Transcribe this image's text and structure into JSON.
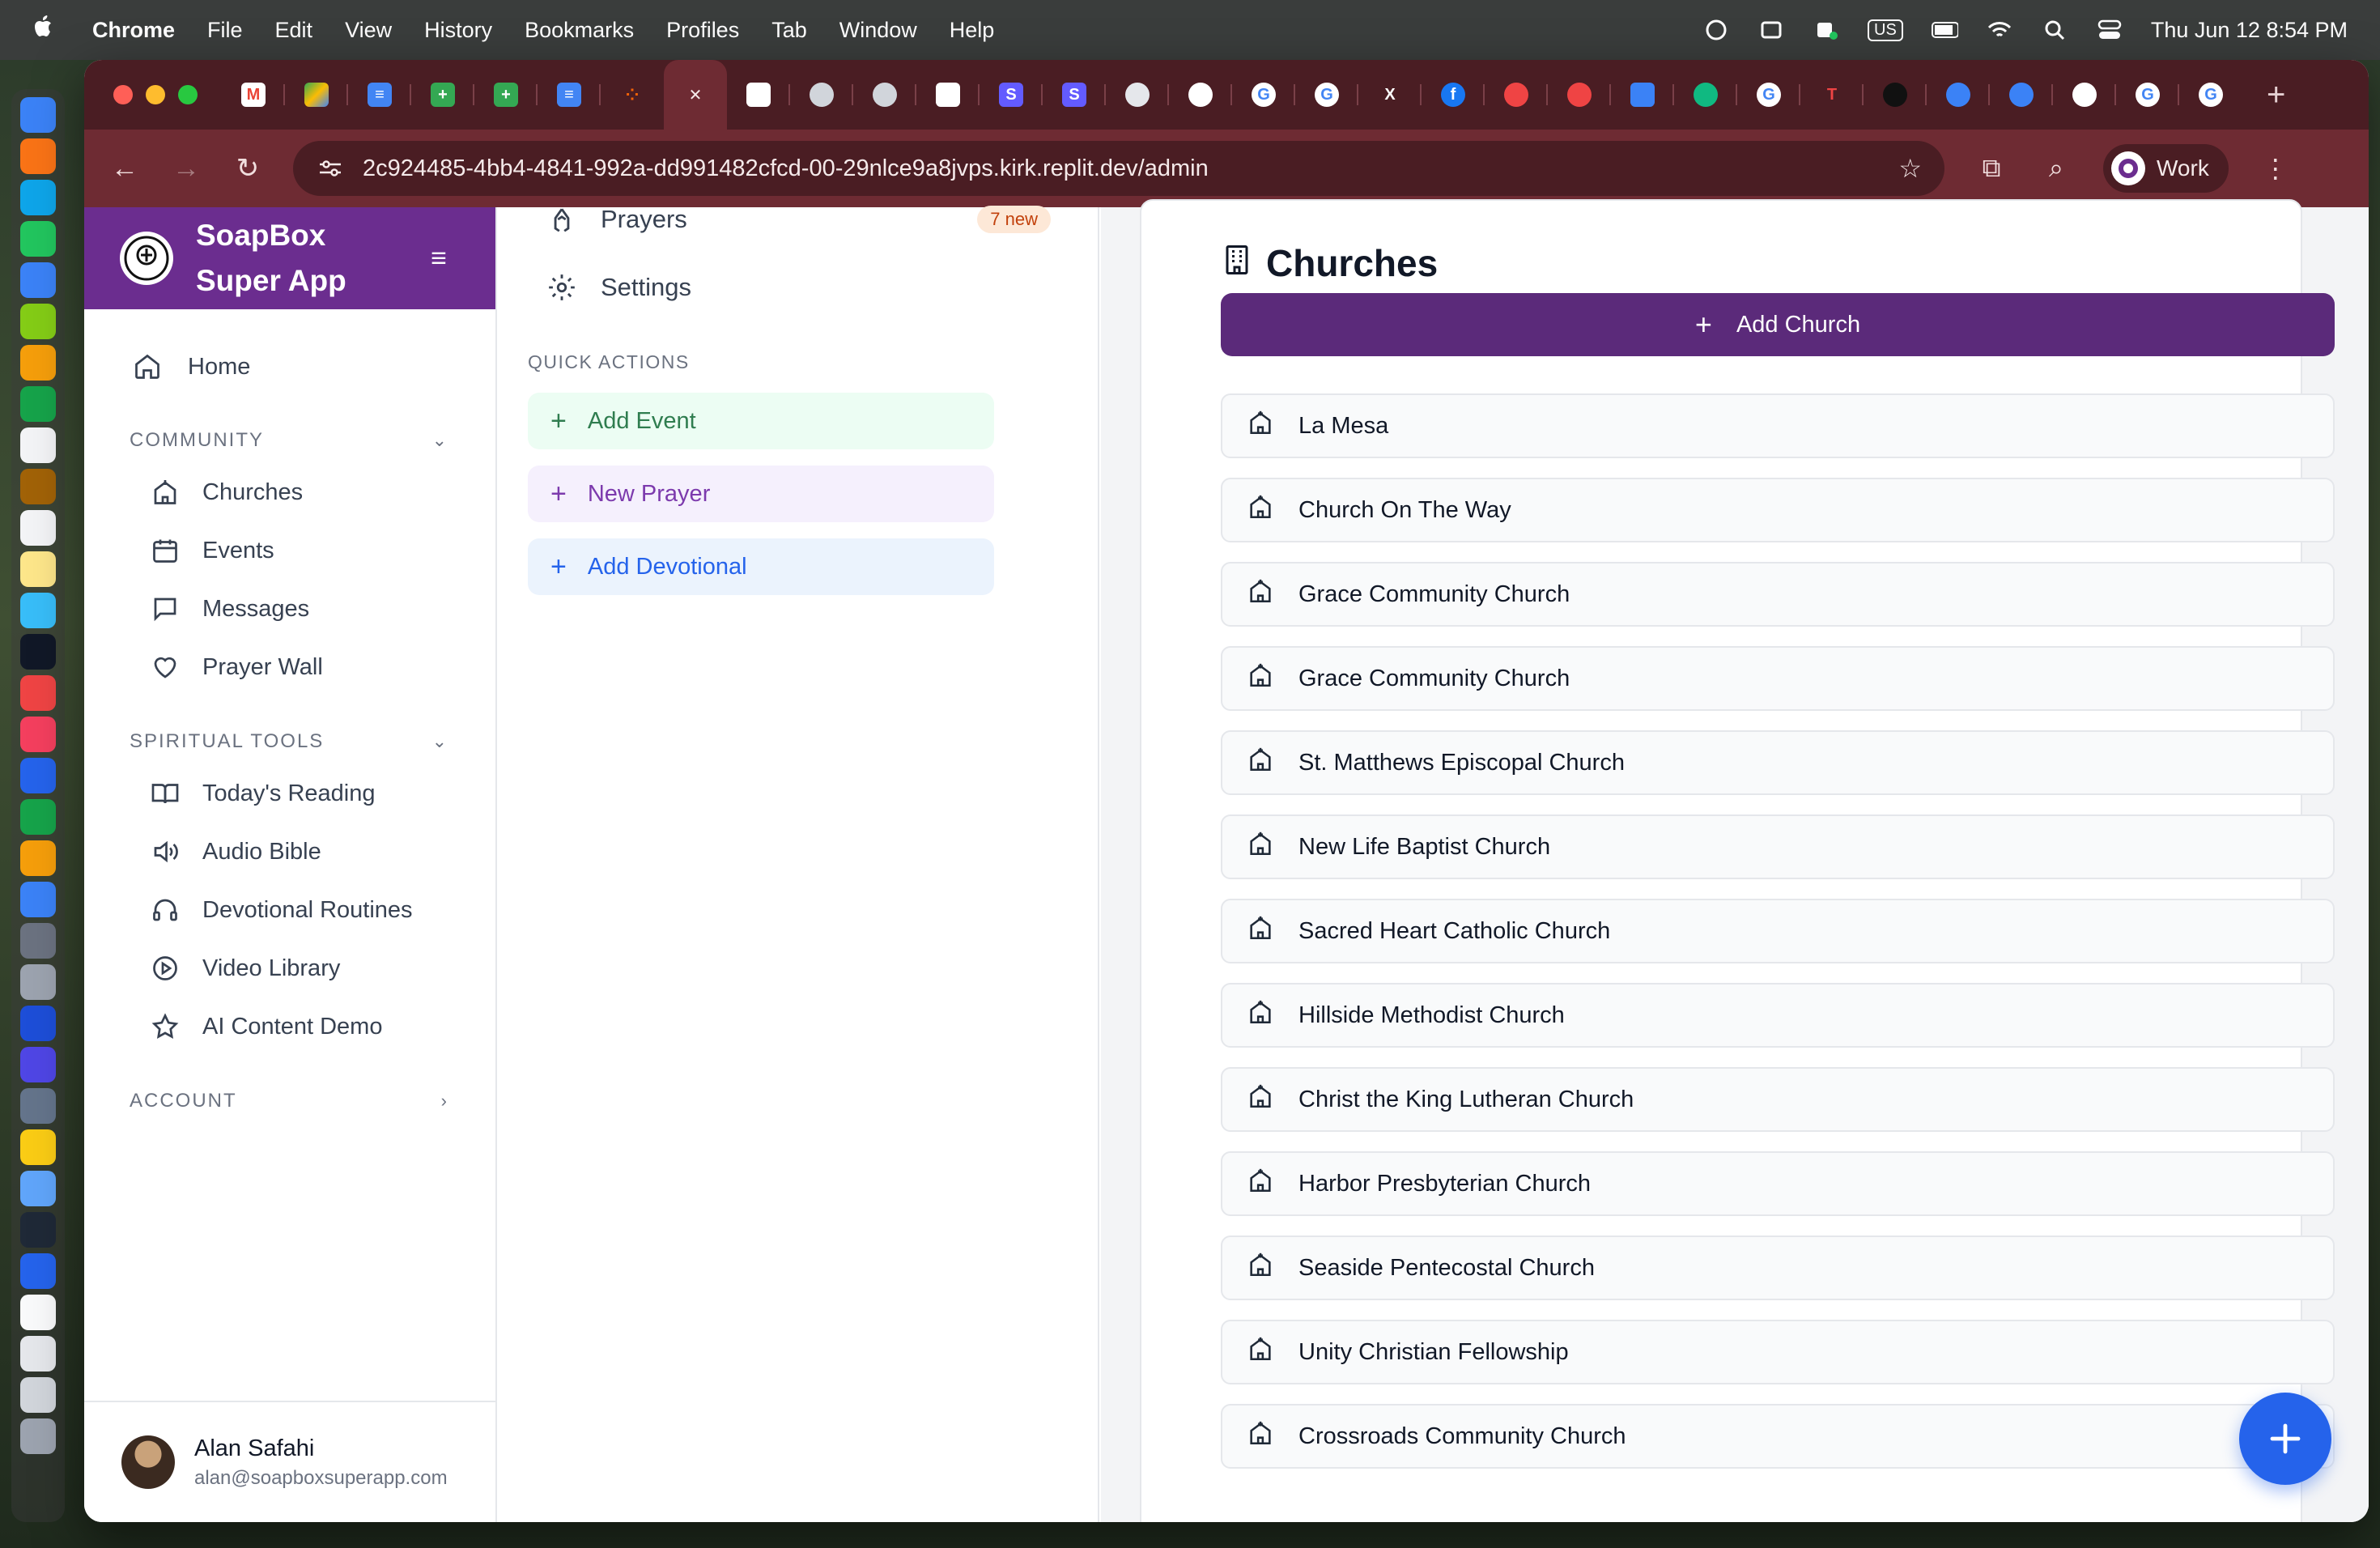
{
  "menubar": {
    "app": "Chrome",
    "items": [
      "File",
      "Edit",
      "View",
      "History",
      "Bookmarks",
      "Profiles",
      "Tab",
      "Window",
      "Help"
    ],
    "keyboard": "US",
    "datetime": "Thu Jun 12  8:54 PM"
  },
  "browser": {
    "url": "2c924485-4bb4-4841-992a-dd991482cfcd-00-29nlce9a8jvps.kirk.replit.dev/admin",
    "profile_label": "Work",
    "close_tab_glyph": "✕",
    "new_tab_glyph": "+"
  },
  "sidebar": {
    "brand_line1": "SoapBox",
    "brand_line2": "Super App",
    "home_label": "Home",
    "community_header": "COMMUNITY",
    "community_items": [
      "Churches",
      "Events",
      "Messages",
      "Prayer Wall"
    ],
    "tools_header": "SPIRITUAL TOOLS",
    "tools_items": [
      "Today's Reading",
      "Audio Bible",
      "Devotional Routines",
      "Video Library",
      "AI Content Demo"
    ],
    "account_header": "ACCOUNT",
    "user_name": "Alan Safahi",
    "user_email": "alan@soapboxsuperapp.com"
  },
  "midcol": {
    "prayers_label": "Prayers",
    "prayers_badge": "7 new",
    "settings_label": "Settings",
    "quick_actions_title": "QUICK ACTIONS",
    "qa_add_event": "Add Event",
    "qa_new_prayer": "New Prayer",
    "qa_add_devotional": "Add Devotional"
  },
  "main": {
    "title": "Churches",
    "add_button": "Add Church",
    "churches": [
      "La Mesa",
      "Church On The Way",
      "Grace Community Church",
      "Grace Community Church",
      "St. Matthews Episcopal Church",
      "New Life Baptist Church",
      "Sacred Heart Catholic Church",
      "Hillside Methodist Church",
      "Christ the King Lutheran Church",
      "Harbor Presbyterian Church",
      "Seaside Pentecostal Church",
      "Unity Christian Fellowship",
      "Crossroads Community Church"
    ]
  },
  "colors": {
    "brand_purple": "#6b2d8f",
    "add_church_bg": "#5b2a7a",
    "fab_blue": "#2563eb",
    "chrome_frame": "#6e2b33"
  }
}
